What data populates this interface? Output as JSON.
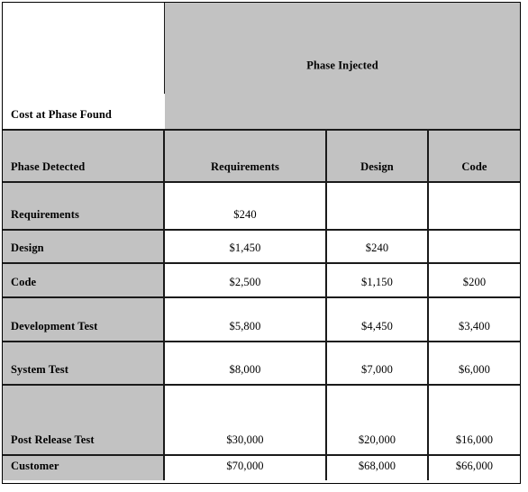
{
  "document": {
    "kind": "cost-of-defect-matrix-table",
    "colors": {
      "header_fill": "#c2c2c2",
      "cell_fill": "#ffffff",
      "rule": "#1a1a1a",
      "text": "#000000"
    }
  },
  "banner": {
    "corner_label": "Cost at Phase Found",
    "injected_label": "Phase Injected"
  },
  "table": {
    "row_header_label": "Phase Detected",
    "columns": [
      "Requirements",
      "Design",
      "Code"
    ],
    "rows": [
      {
        "label": "Requirements",
        "values": [
          "$240",
          "",
          ""
        ]
      },
      {
        "label": "Design",
        "values": [
          "$1,450",
          "$240",
          ""
        ]
      },
      {
        "label": "Code",
        "values": [
          "$2,500",
          "$1,150",
          "$200"
        ]
      },
      {
        "label": "Development Test",
        "values": [
          "$5,800",
          "$4,450",
          "$3,400"
        ]
      },
      {
        "label": "System Test",
        "values": [
          "$8,000",
          "$7,000",
          "$6,000"
        ]
      },
      {
        "label": "Post Release Test",
        "values": [
          "$30,000",
          "$20,000",
          "$16,000"
        ]
      },
      {
        "label": "Customer",
        "values": [
          "$70,000",
          "$68,000",
          "$66,000"
        ]
      }
    ]
  }
}
